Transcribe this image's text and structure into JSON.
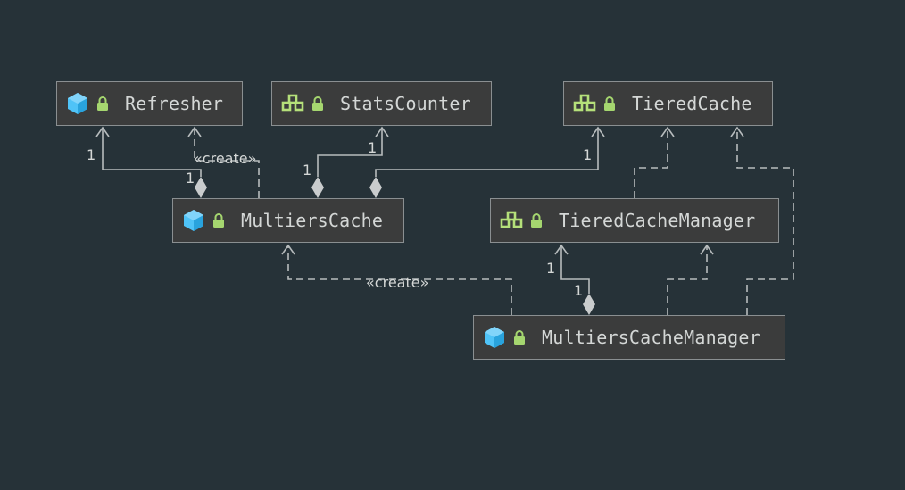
{
  "colors": {
    "background": "#263238",
    "node_fill": "#3b3c3c",
    "node_border": "#8a8f91",
    "text": "#d4d7d6",
    "class_icon": "#4fc3f7",
    "interface_icon": "#b5e07a",
    "lock_icon": "#a5d66f",
    "edge": "#b7bcbd",
    "diamond": "#c9cccd"
  },
  "nodes": {
    "refresher": {
      "name": "Refresher",
      "kind": "class",
      "icon": "class-icon"
    },
    "stats_counter": {
      "name": "StatsCounter",
      "kind": "interface",
      "icon": "interface-icon"
    },
    "tiered_cache": {
      "name": "TieredCache",
      "kind": "interface",
      "icon": "interface-icon"
    },
    "multiers_cache": {
      "name": "MultiersCache",
      "kind": "class",
      "icon": "class-icon"
    },
    "tiered_cache_manager": {
      "name": "TieredCacheManager",
      "kind": "interface",
      "icon": "interface-icon"
    },
    "multiers_cache_manager": {
      "name": "MultiersCacheManager",
      "kind": "class",
      "icon": "class-icon"
    }
  },
  "labels": {
    "create_1": "«create»",
    "create_2": "«create»",
    "mult_refresher_target": "1",
    "mult_refresher_source": "1",
    "mult_stats_target": "1",
    "mult_stats_source": "1",
    "mult_tiered_target": "1",
    "mult_tcm_target": "1",
    "mult_tcm_source": "1"
  }
}
